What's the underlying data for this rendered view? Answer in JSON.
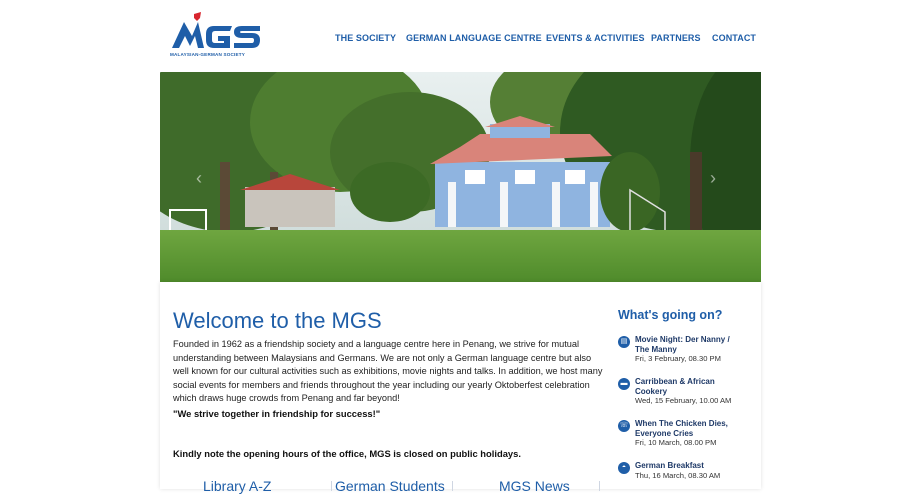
{
  "brand": {
    "logo_text": "MGS",
    "tagline": "MALAYSIAN-GERMAN SOCIETY",
    "primary_color": "#1f5ea8",
    "accent_color": "#d8262e"
  },
  "nav": {
    "items": [
      {
        "label": "THE SOCIETY"
      },
      {
        "label": "GERMAN LANGUAGE CENTRE"
      },
      {
        "label": "EVENTS & ACTIVITIES"
      },
      {
        "label": "PARTNERS"
      },
      {
        "label": "CONTACT"
      }
    ]
  },
  "hero": {
    "prev_icon": "chevron-left-icon",
    "next_icon": "chevron-right-icon",
    "prev_glyph": "‹",
    "next_glyph": "›"
  },
  "main": {
    "title": "Welcome to the MGS",
    "intro": "Founded in 1962 as a friendship society and a language centre here in Penang, we strive for mutual understanding between Malaysians and Germans. We are not only a German language centre but also well known for our cultural activities such as exhibitions, movie nights and talks. In addition, we host many social events for members and friends throughout the year including our yearly Oktoberfest celebration which draws huge crowds from Penang and far beyond!",
    "motto": "\"We strive together in friendship for success!\"",
    "note": "Kindly note the opening hours of the office, MGS is closed on public holidays.",
    "quicklinks": [
      {
        "label": "Library A-Z"
      },
      {
        "label": "German Students"
      },
      {
        "label": "MGS News"
      }
    ]
  },
  "sidebar": {
    "title": "What's going on?",
    "events": [
      {
        "icon": "film-icon",
        "glyph": "▤",
        "title": "Movie Night: Der Nanny / The Manny",
        "date": "Fri, 3 February, 08.30 PM"
      },
      {
        "icon": "cooking-icon",
        "glyph": "▬",
        "title": "Carribbean & African Cookery",
        "date": "Wed, 15 February, 10.00 AM"
      },
      {
        "icon": "chat-icon",
        "glyph": "☏",
        "title": "When The Chicken Dies, Everyone Cries",
        "date": "Fri, 10 March, 08.00 PM"
      },
      {
        "icon": "breakfast-icon",
        "glyph": "◓",
        "title": "German Breakfast",
        "date": "Thu, 16 March, 08.30 AM"
      }
    ]
  }
}
